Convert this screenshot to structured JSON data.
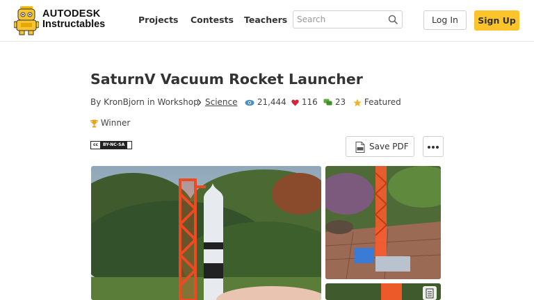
{
  "header": {
    "brand_top": "AUTODESK",
    "brand_bottom": "Instructables",
    "nav": [
      "Projects",
      "Contests",
      "Teachers"
    ],
    "search_placeholder": "Search",
    "login_label": "Log In",
    "signup_label": "Sign Up",
    "signup_color": "#fac42a"
  },
  "article": {
    "title": "SaturnV Vacuum Rocket Launcher",
    "by_prefix": "By",
    "author": "KronBjorn",
    "in_word": "in",
    "category": "Workshop",
    "subcategory": "Science",
    "views": "21,444",
    "favorites": "116",
    "comments": "23",
    "featured_label": "Featured",
    "award_label": "Winner",
    "license": {
      "left": "cc",
      "right": "BY-NC-SA"
    },
    "save_pdf_label": "Save PDF"
  },
  "colors": {
    "views_icon": "#4a8fc7",
    "heart_icon": "#d0283b",
    "comments_icon": "#5aaa3c",
    "star_icon": "#f0b429",
    "trophy_icon": "#e8a317"
  },
  "icons": [
    "search-icon",
    "eye-icon",
    "heart-icon",
    "comment-icon",
    "star-icon",
    "trophy-icon",
    "pdf-icon",
    "more-icon",
    "chevron-right-icon",
    "document-icon"
  ]
}
